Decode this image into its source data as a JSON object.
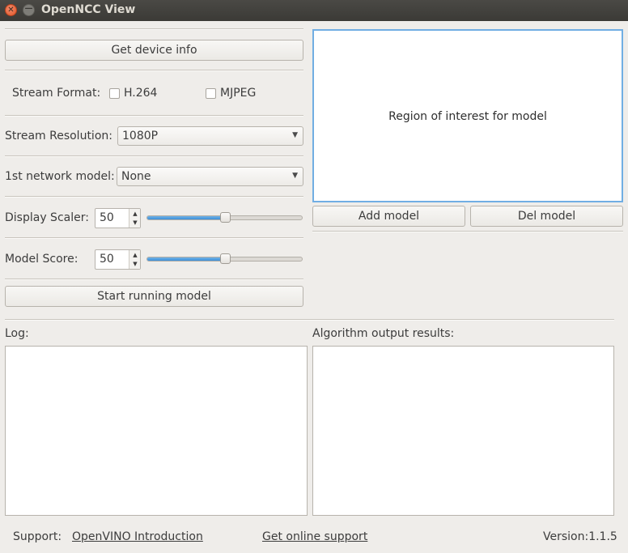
{
  "window": {
    "title": "OpenNCC View"
  },
  "controls": {
    "get_device_info": "Get device info",
    "stream_format": {
      "label": "Stream Format:",
      "options": [
        "H.264",
        "MJPEG"
      ]
    },
    "stream_resolution": {
      "label": "Stream Resolution:",
      "value": "1080P"
    },
    "network_model": {
      "label": "1st network model:",
      "value": "None"
    },
    "display_scaler": {
      "label": "Display Scaler:",
      "value": "50",
      "level_percent": 50
    },
    "model_score": {
      "label": "Model Score:",
      "value": "50",
      "level_percent": 50
    },
    "start_running": "Start running model"
  },
  "roi": {
    "text": "Region of interest for model",
    "add_model": "Add model",
    "del_model": "Del model"
  },
  "log": {
    "label": "Log:"
  },
  "algo": {
    "label": "Algorithm output results:"
  },
  "footer": {
    "support_label": "Support:",
    "openvino_link": "OpenVINO Introduction",
    "online_support_link": "Get online support",
    "version": "Version:1.1.5"
  },
  "colors": {
    "accent": "#3c8fd8",
    "roi_border": "#71aee3",
    "titlebar": "#3b3a36",
    "close_button": "#e1572a"
  }
}
